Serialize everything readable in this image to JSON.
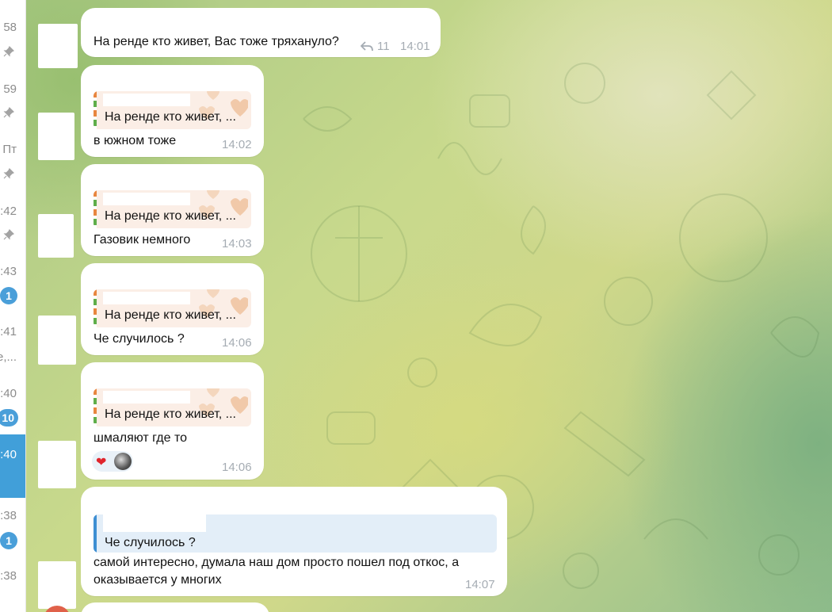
{
  "sidebar": {
    "rows": [
      {
        "time": "58",
        "pinned": true,
        "badge": "",
        "preview": "",
        "active": false
      },
      {
        "time": "59",
        "pinned": true,
        "badge": "",
        "preview": "",
        "active": false
      },
      {
        "time": "Пт",
        "pinned": true,
        "badge": "",
        "preview": "",
        "active": false
      },
      {
        "time": ":42",
        "pinned": true,
        "badge": "",
        "preview": "",
        "active": false
      },
      {
        "time": ":43",
        "pinned": false,
        "badge": "1",
        "preview": "",
        "active": false
      },
      {
        "time": ":41",
        "pinned": false,
        "badge": "",
        "preview": "е,...",
        "active": false
      },
      {
        "time": ":40",
        "pinned": false,
        "badge": "10",
        "preview": "",
        "active": false
      },
      {
        "time": ":40",
        "pinned": false,
        "badge": "",
        "preview": "",
        "active": true
      },
      {
        "time": ":38",
        "pinned": false,
        "badge": "1",
        "preview": "",
        "active": false
      },
      {
        "time": ":38",
        "pinned": false,
        "badge": "",
        "preview": "",
        "active": false
      }
    ]
  },
  "messages": [
    {
      "text": "На ренде кто живет, Вас тоже тряхануло?",
      "replies_count": "11",
      "time": "14:01"
    },
    {
      "reply_to": "На ренде кто живет, ...",
      "text": "в южном тоже",
      "time": "14:02"
    },
    {
      "reply_to": "На ренде кто живет, ...",
      "text": "Газовик немного",
      "time": "14:03"
    },
    {
      "reply_to": "На ренде кто живет, ...",
      "text": "Че случилось ?",
      "time": "14:06"
    },
    {
      "reply_to": "На ренде кто живет, ...",
      "text": "шмаляют где то",
      "time": "14:06",
      "reaction": "heart"
    },
    {
      "reply_to": "Че случилось ?",
      "text_line1": "самой интересно, думала наш дом просто пошел под откос, а",
      "text_line2": "оказывается у многих",
      "time": "14:07"
    }
  ],
  "colors": {
    "accent": "#419fd9",
    "reply_orange": "#e8863f",
    "reply_green": "#5fae4a",
    "reply_blue": "#3e8fd3",
    "bubble": "#ffffff"
  }
}
